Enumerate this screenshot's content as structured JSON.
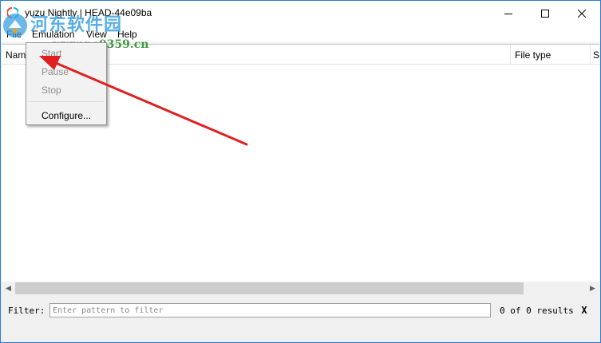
{
  "window": {
    "title": "yuzu Nightly | HEAD-44e09ba",
    "controls": [
      "minimize",
      "maximize",
      "close"
    ]
  },
  "menubar": {
    "items": [
      "File",
      "Emulation",
      "View",
      "Help"
    ]
  },
  "emulation_menu": {
    "items": [
      {
        "label": "Start",
        "enabled": false
      },
      {
        "label": "Pause",
        "enabled": false
      },
      {
        "label": "Stop",
        "enabled": false
      },
      {
        "label": "Configure...",
        "enabled": true
      }
    ]
  },
  "game_list": {
    "columns": [
      "Name",
      "File type",
      "S"
    ],
    "rows": []
  },
  "filter": {
    "label": "Filter:",
    "placeholder": "Enter pattern to filter",
    "value": "",
    "results": "0 of 0 results",
    "clear_label": "X"
  },
  "watermark": {
    "line1": "河东软件园",
    "line2": "www.pc0359.cn"
  },
  "colors": {
    "accent_border": "#2b7bd4",
    "annotation_arrow": "#e02020",
    "watermark_blue": "#3aa0e0",
    "watermark_green": "#3c9b3c"
  }
}
